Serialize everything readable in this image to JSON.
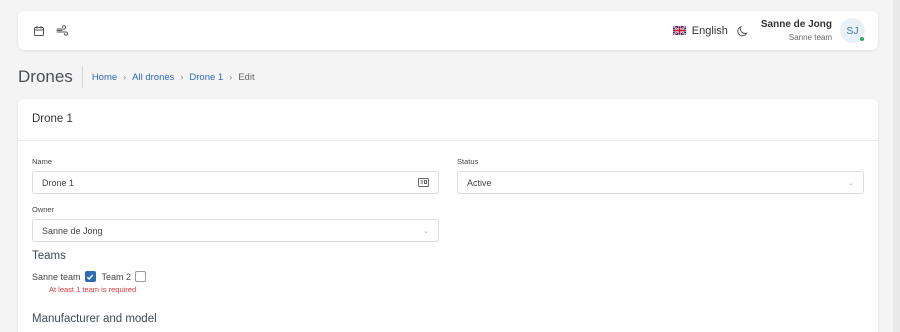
{
  "header": {
    "language": "English",
    "user": {
      "name": "Sanne de Jong",
      "team": "Sanne team",
      "initials": "SJ"
    },
    "icons": [
      "calendar-icon",
      "wind-icon",
      "flag-uk-icon",
      "moon-icon"
    ],
    "status_color": "#27ae60"
  },
  "page": {
    "title": "Drones",
    "breadcrumb": {
      "home": "Home",
      "all": "All drones",
      "item": "Drone 1",
      "current": "Edit",
      "sep": "›"
    }
  },
  "form": {
    "card_title": "Drone 1",
    "name": {
      "label": "Name",
      "value": "Drone 1"
    },
    "status": {
      "label": "Status",
      "value": "Active"
    },
    "owner": {
      "label": "Owner",
      "value": "Sanne de Jong"
    },
    "teams": {
      "heading": "Teams",
      "options": [
        {
          "label": "Sanne team",
          "checked": true
        },
        {
          "label": "Team 2",
          "checked": false
        }
      ],
      "error": "At least 1 team is required"
    },
    "manufacturer_heading": "Manufacturer and model"
  },
  "colors": {
    "accent": "#2d6cb5",
    "error": "#d9383a",
    "background": "#f4f4f5"
  }
}
